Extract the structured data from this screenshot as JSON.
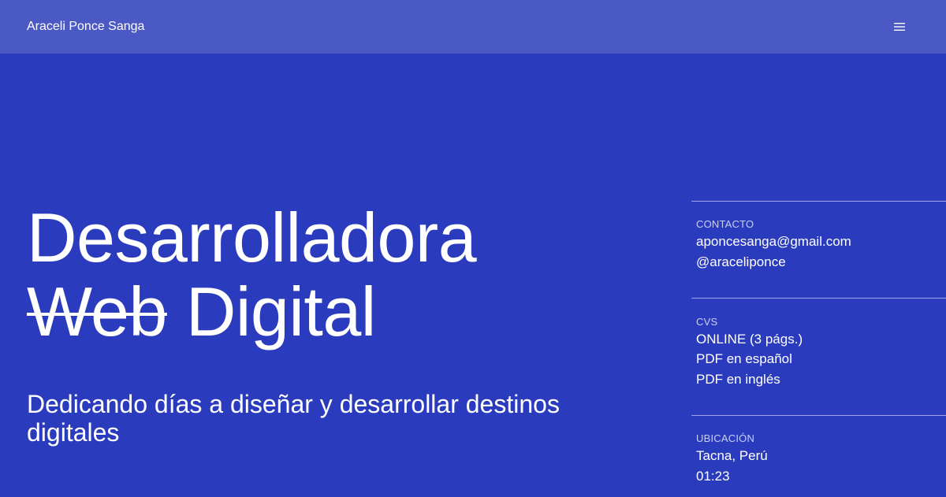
{
  "header": {
    "brand": "Araceli Ponce Sanga",
    "menu_icon": "hamburger-menu-icon"
  },
  "hero": {
    "line1": "Desarrolladora",
    "line2_struck": "Web",
    "line2_rest": "Digital",
    "tagline": "Dedicando días a diseñar y desarrollar destinos digitales"
  },
  "sidebar": {
    "contact": {
      "label": "CONTACTO",
      "email": "aponcesanga@gmail.com",
      "handle": "@araceliponce"
    },
    "cvs": {
      "label": "CVS",
      "online": "ONLINE (3 págs.)",
      "pdf_es": "PDF en español",
      "pdf_en": "PDF en inglés"
    },
    "location": {
      "label": "UBICACIÓN",
      "city": "Tacna, Perú",
      "time": "01:23"
    }
  },
  "colors": {
    "background": "#2a3cbd",
    "header_background": "#4a59c3",
    "text": "#ffffff",
    "label_text": "#c9cff2"
  }
}
